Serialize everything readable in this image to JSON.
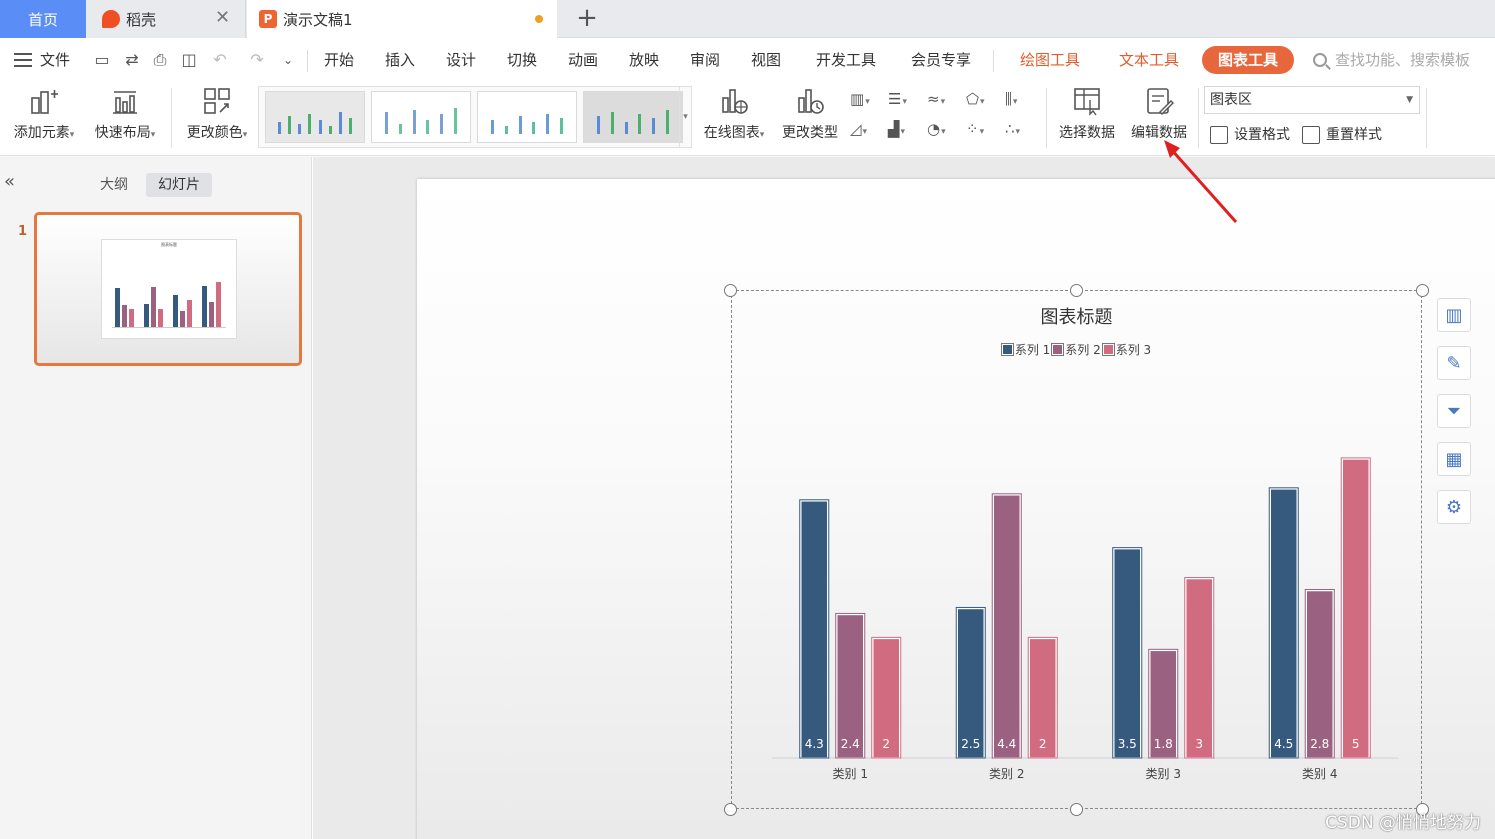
{
  "tabs": {
    "home": "首页",
    "daoke": "稻壳",
    "doc": "演示文稿1"
  },
  "menu": {
    "file": "文件",
    "items": [
      "开始",
      "插入",
      "设计",
      "切换",
      "动画",
      "放映",
      "审阅",
      "视图",
      "开发工具",
      "会员专享"
    ],
    "context_tools": [
      "绘图工具",
      "文本工具"
    ],
    "active_tool": "图表工具",
    "search_placeholder": "查找功能、搜索模板"
  },
  "ribbon": {
    "add_element": "添加元素",
    "quick_layout": "快速布局",
    "change_color": "更改颜色",
    "online_chart": "在线图表",
    "change_type": "更改类型",
    "select_data": "选择数据",
    "edit_data": "编辑数据",
    "area_select": "图表区",
    "set_format": "设置格式",
    "reset_style": "重置样式"
  },
  "left_panel": {
    "outline_tab": "大纲",
    "slides_tab": "幻灯片",
    "slide_number": "1"
  },
  "colors": {
    "series1": "#365a7d",
    "series2": "#9a6280",
    "series3": "#d06b80",
    "accent": "#e8663b"
  },
  "chart_data": {
    "type": "bar",
    "title": "图表标题",
    "categories": [
      "类别 1",
      "类别 2",
      "类别 3",
      "类别 4"
    ],
    "series": [
      {
        "name": "系列 1",
        "values": [
          4.3,
          2.5,
          3.5,
          4.5
        ]
      },
      {
        "name": "系列 2",
        "values": [
          2.4,
          4.4,
          1.8,
          2.8
        ]
      },
      {
        "name": "系列 3",
        "values": [
          2,
          2,
          3,
          5
        ]
      }
    ],
    "ylim": [
      0,
      5.5
    ],
    "legend": "top",
    "grid": false,
    "data_labels": true
  },
  "watermark": "CSDN @悄悄地努力"
}
